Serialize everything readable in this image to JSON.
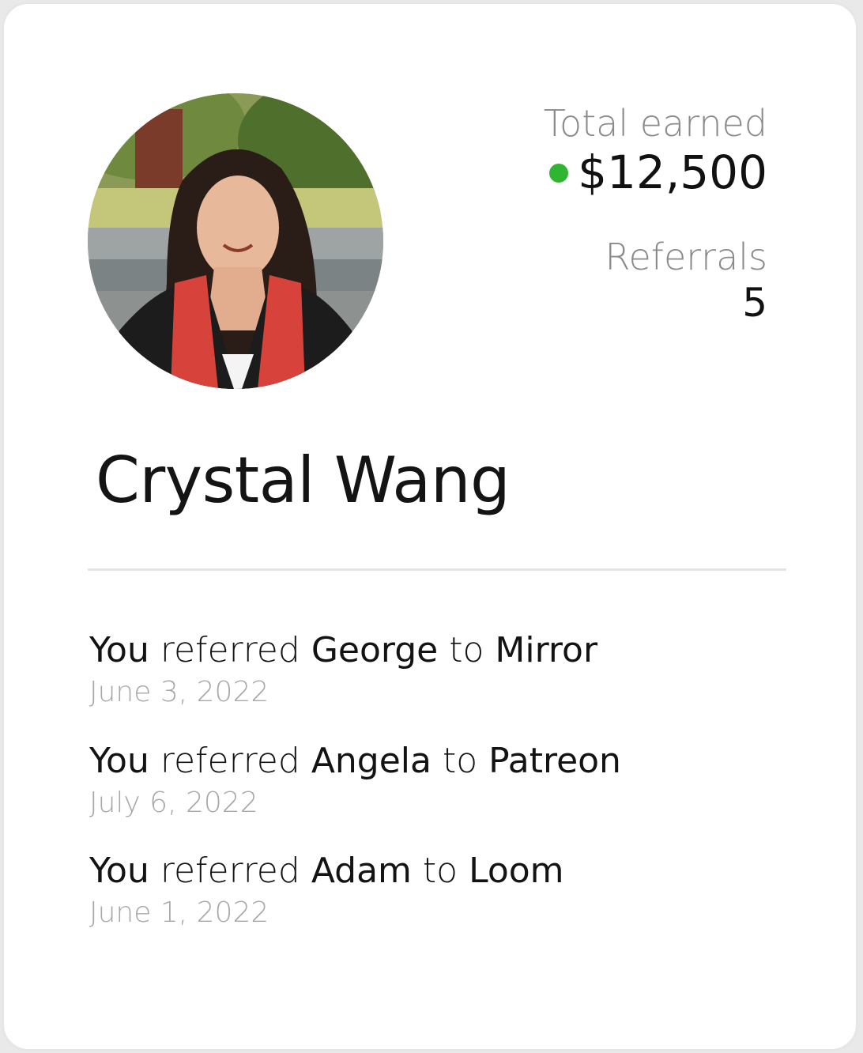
{
  "profile": {
    "name": "Crystal Wang",
    "avatar_alt": "profile photo"
  },
  "stats": {
    "total_label": "Total earned",
    "total_value": "$12,500",
    "status_color": "#2fb52f",
    "referrals_label": "Referrals",
    "referrals_value": "5"
  },
  "activity": [
    {
      "you": "You",
      "verb": "referred",
      "person": "George",
      "to": "to",
      "company": "Mirror",
      "date": "June 3, 2022"
    },
    {
      "you": "You",
      "verb": "referred",
      "person": "Angela",
      "to": "to",
      "company": "Patreon",
      "date": "July 6, 2022"
    },
    {
      "you": "You",
      "verb": "referred",
      "person": "Adam",
      "to": "to",
      "company": "Loom",
      "date": "June 1, 2022"
    }
  ]
}
